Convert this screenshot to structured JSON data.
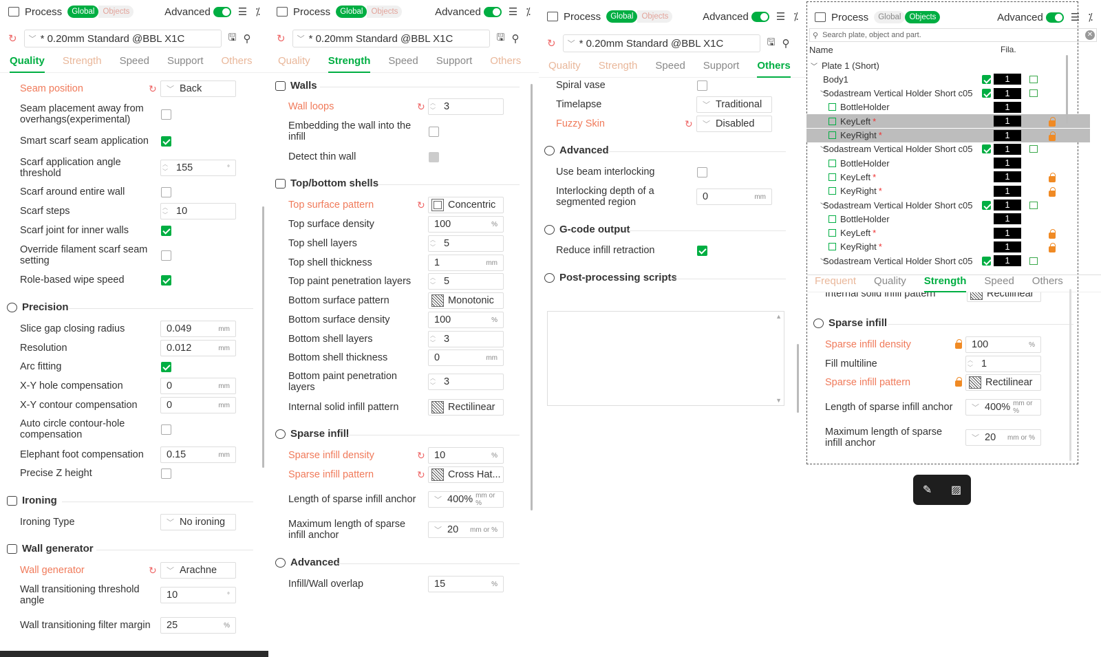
{
  "header": {
    "process": "Process",
    "global": "Global",
    "objects": "Objects",
    "advanced": "Advanced",
    "list_icon": "list-icon",
    "tool_icon": "wand-icon"
  },
  "preset": "* 0.20mm Standard @BBL X1C",
  "tabs": {
    "quality": "Quality",
    "strength": "Strength",
    "speed": "Speed",
    "support": "Support",
    "others": "Others"
  },
  "p1": {
    "seam_position": "Seam position",
    "seam_position_val": "Back",
    "seam_away": "Seam placement away from overhangs(experimental)",
    "smart_scarf": "Smart scarf seam application",
    "scarf_angle": "Scarf application angle threshold",
    "scarf_angle_val": "155",
    "deg": "°",
    "scarf_entire": "Scarf around entire wall",
    "scarf_steps": "Scarf steps",
    "scarf_steps_val": "10",
    "scarf_inner": "Scarf joint for inner walls",
    "override_scarf": "Override filament scarf seam setting",
    "role_wipe": "Role-based wipe speed",
    "precision": "Precision",
    "slice_gap": "Slice gap closing radius",
    "slice_gap_val": "0.049",
    "resolution": "Resolution",
    "resolution_val": "0.012",
    "arc_fitting": "Arc fitting",
    "xy_hole": "X-Y hole compensation",
    "xy_hole_val": "0",
    "xy_contour": "X-Y contour compensation",
    "xy_contour_val": "0",
    "auto_circle": "Auto circle contour-hole compensation",
    "elephant": "Elephant foot compensation",
    "elephant_val": "0.15",
    "precise_z": "Precise Z height",
    "ironing": "Ironing",
    "ironing_type": "Ironing Type",
    "ironing_type_val": "No ironing",
    "wall_generator_sec": "Wall generator",
    "wall_generator": "Wall generator",
    "wall_generator_val": "Arachne",
    "wall_trans_angle": "Wall transitioning threshold angle",
    "wall_trans_angle_val": "10",
    "wall_trans_filter": "Wall transitioning filter margin",
    "wall_trans_filter_val": "25",
    "mm": "mm",
    "pct": "%"
  },
  "p2": {
    "walls": "Walls",
    "wall_loops": "Wall loops",
    "wall_loops_val": "3",
    "embed": "Embedding the wall into the infill",
    "detect_thin": "Detect thin wall",
    "topbottom": "Top/bottom shells",
    "top_pattern": "Top surface pattern",
    "top_pattern_val": "Concentric",
    "top_density": "Top surface density",
    "top_density_val": "100",
    "top_layers": "Top shell layers",
    "top_layers_val": "5",
    "top_thick": "Top shell thickness",
    "top_thick_val": "1",
    "top_paint": "Top paint penetration layers",
    "top_paint_val": "5",
    "bot_pattern": "Bottom surface pattern",
    "bot_pattern_val": "Monotonic",
    "bot_density": "Bottom surface density",
    "bot_density_val": "100",
    "bot_layers": "Bottom shell layers",
    "bot_layers_val": "3",
    "bot_thick": "Bottom shell thickness",
    "bot_thick_val": "0",
    "bot_paint": "Bottom paint penetration layers",
    "bot_paint_val": "3",
    "internal_pattern": "Internal solid infill pattern",
    "internal_pattern_val": "Rectilinear",
    "sparse": "Sparse infill",
    "sparse_density": "Sparse infill density",
    "sparse_density_val": "10",
    "sparse_pattern": "Sparse infill pattern",
    "sparse_pattern_val": "Cross Hat...",
    "anchor": "Length of sparse infill anchor",
    "anchor_val": "400%",
    "anchor_u": "mm or %",
    "max_anchor": "Maximum length of sparse infill anchor",
    "max_anchor_val": "20",
    "advanced": "Advanced",
    "overlap": "Infill/Wall overlap",
    "overlap_val": "15"
  },
  "p3": {
    "spiral": "Spiral vase",
    "timelapse": "Timelapse",
    "timelapse_val": "Traditional",
    "fuzzy": "Fuzzy Skin",
    "fuzzy_val": "Disabled",
    "advanced": "Advanced",
    "beam": "Use beam interlocking",
    "interlock_depth": "Interlocking depth of a segmented region",
    "interlock_depth_val": "0",
    "gcode": "G-code output",
    "reduce_retract": "Reduce infill retraction",
    "post": "Post-processing scripts"
  },
  "p4": {
    "search_placeholder": "Search plate, object and part.",
    "col_name": "Name",
    "col_fila": "Fila.",
    "tree": [
      {
        "name": "Plate 1 (Short)",
        "level": 0,
        "exp": true,
        "fil": "",
        "cube": false,
        "check": false,
        "lock": false,
        "sel": false,
        "part": false
      },
      {
        "name": "Body1",
        "level": 1,
        "exp": false,
        "fil": "1",
        "cube": true,
        "check": true,
        "lock": false,
        "sel": false,
        "part": false
      },
      {
        "name": "Sodastream Vertical Holder Short c05",
        "level": 1,
        "exp": true,
        "fil": "1",
        "cube": true,
        "check": true,
        "lock": false,
        "sel": false,
        "part": false
      },
      {
        "name": "BottleHolder",
        "level": 2,
        "exp": false,
        "fil": "1",
        "cube": false,
        "check": false,
        "lock": false,
        "sel": false,
        "part": true
      },
      {
        "name": "KeyLeft",
        "level": 2,
        "exp": false,
        "fil": "1",
        "cube": false,
        "check": false,
        "lock": true,
        "sel": true,
        "part": true,
        "mod": "*"
      },
      {
        "name": "KeyRight",
        "level": 2,
        "exp": false,
        "fil": "1",
        "cube": false,
        "check": false,
        "lock": true,
        "sel": true,
        "part": true,
        "mod": "*"
      },
      {
        "name": "Sodastream Vertical Holder Short c05",
        "level": 1,
        "exp": true,
        "fil": "1",
        "cube": true,
        "check": true,
        "lock": false,
        "sel": false,
        "part": false
      },
      {
        "name": "BottleHolder",
        "level": 2,
        "exp": false,
        "fil": "1",
        "cube": false,
        "check": false,
        "lock": false,
        "sel": false,
        "part": true
      },
      {
        "name": "KeyLeft",
        "level": 2,
        "exp": false,
        "fil": "1",
        "cube": false,
        "check": false,
        "lock": true,
        "sel": false,
        "part": true,
        "mod": "*"
      },
      {
        "name": "KeyRight",
        "level": 2,
        "exp": false,
        "fil": "1",
        "cube": false,
        "check": false,
        "lock": true,
        "sel": false,
        "part": true,
        "mod": "*"
      },
      {
        "name": "Sodastream Vertical Holder Short c05",
        "level": 1,
        "exp": true,
        "fil": "1",
        "cube": true,
        "check": true,
        "lock": false,
        "sel": false,
        "part": false
      },
      {
        "name": "BottleHolder",
        "level": 2,
        "exp": false,
        "fil": "1",
        "cube": false,
        "check": false,
        "lock": false,
        "sel": false,
        "part": true
      },
      {
        "name": "KeyLeft",
        "level": 2,
        "exp": false,
        "fil": "1",
        "cube": false,
        "check": false,
        "lock": true,
        "sel": false,
        "part": true,
        "mod": "*"
      },
      {
        "name": "KeyRight",
        "level": 2,
        "exp": false,
        "fil": "1",
        "cube": false,
        "check": false,
        "lock": true,
        "sel": false,
        "part": true,
        "mod": "*"
      },
      {
        "name": "Sodastream Vertical Holder Short c05",
        "level": 1,
        "exp": true,
        "fil": "1",
        "cube": true,
        "check": true,
        "lock": false,
        "sel": false,
        "part": false
      }
    ],
    "tabs": {
      "frequent": "Frequent",
      "quality": "Quality",
      "strength": "Strength",
      "speed": "Speed",
      "others": "Others"
    },
    "internal_pattern": "Internal solid infill pattern",
    "internal_pattern_val": "Rectilinear",
    "sparse": "Sparse infill",
    "sparse_density": "Sparse infill density",
    "sparse_density_val": "100",
    "fill_multi": "Fill multiline",
    "fill_multi_val": "1",
    "sparse_pattern": "Sparse infill pattern",
    "sparse_pattern_val": "Rectilinear",
    "anchor": "Length of sparse infill anchor",
    "anchor_val": "400%",
    "anchor_u": "mm or %",
    "max_anchor": "Maximum length of sparse infill anchor",
    "max_anchor_val": "20"
  },
  "floatbar": {
    "icon1": "paint-brush-icon",
    "icon2": "hatch-icon"
  },
  "colors": {
    "accent": "#00ae42",
    "modified": "#f07a5a",
    "lock": "#f08a24"
  }
}
